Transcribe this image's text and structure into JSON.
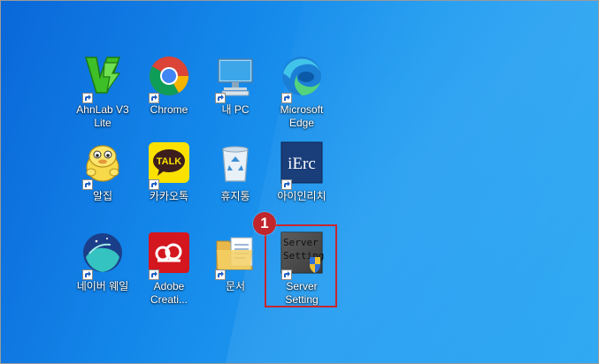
{
  "desktop": {
    "icons": [
      {
        "label": "AhnLab V3\nLite",
        "icon": "ahnlab-v3-icon"
      },
      {
        "label": "Chrome",
        "icon": "chrome-icon"
      },
      {
        "label": "내 PC",
        "icon": "this-pc-icon"
      },
      {
        "label": "Microsoft\nEdge",
        "icon": "edge-icon"
      },
      {
        "label": "알집",
        "icon": "alzip-icon"
      },
      {
        "label": "카카오톡",
        "icon": "kakaotalk-icon"
      },
      {
        "label": "휴지통",
        "icon": "recycle-bin-icon"
      },
      {
        "label": "아이인리치",
        "icon": "ierc-icon"
      },
      {
        "label": "네이버 웨일",
        "icon": "naver-whale-icon"
      },
      {
        "label": "Adobe\nCreati...",
        "icon": "adobe-cc-icon"
      },
      {
        "label": "문서",
        "icon": "documents-folder-icon"
      },
      {
        "label": "Server\nSetting",
        "icon": "server-setting-icon"
      }
    ],
    "kakao_text": "TALK",
    "ierc_text": "iErc",
    "server_icon_text_1": "Server",
    "server_icon_text_2": "Setting"
  },
  "annotation": {
    "callout_number": "1",
    "color": "#c8262e"
  }
}
